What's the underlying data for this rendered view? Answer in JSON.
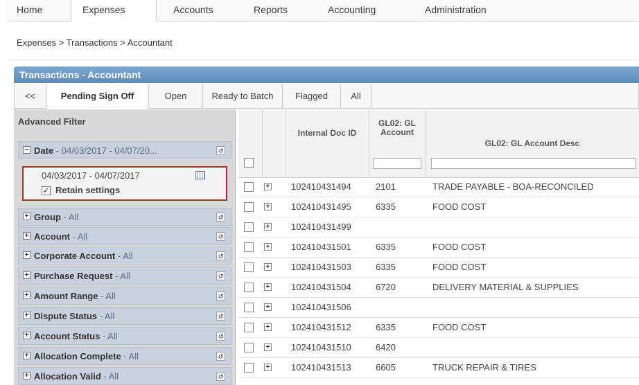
{
  "topnav": {
    "tabs": [
      {
        "label": "Home",
        "active": false
      },
      {
        "label": "Expenses",
        "active": true
      },
      {
        "label": "Accounts",
        "active": false
      },
      {
        "label": "Reports",
        "active": false
      },
      {
        "label": "Accounting",
        "active": false
      },
      {
        "label": "Administration",
        "active": false
      }
    ]
  },
  "breadcrumb": "Expenses > Transactions > Accountant",
  "panel": {
    "title": "Transactions - Accountant"
  },
  "subtabs": [
    {
      "label": "<<"
    },
    {
      "label": "Pending Sign Off",
      "active": true
    },
    {
      "label": "Open"
    },
    {
      "label": "Ready to Batch"
    },
    {
      "label": "Flagged"
    },
    {
      "label": "All"
    }
  ],
  "filter": {
    "title": "Advanced Filter",
    "date": {
      "label": "Date",
      "value": " - 04/03/2017 - 04/07/20...",
      "range": "04/03/2017 - 04/07/2017",
      "retain_label": "Retain settings",
      "retain_checked": true
    },
    "groups": [
      {
        "label": "Group",
        "value": " - All"
      },
      {
        "label": "Account",
        "value": " - All"
      },
      {
        "label": "Corporate Account",
        "value": " - All"
      },
      {
        "label": "Purchase Request",
        "value": " - All"
      },
      {
        "label": "Amount Range",
        "value": " - All"
      },
      {
        "label": "Dispute Status",
        "value": " - All"
      },
      {
        "label": "Account Status",
        "value": " - All"
      },
      {
        "label": "Allocation Complete",
        "value": " - All"
      },
      {
        "label": "Allocation Valid",
        "value": " - All"
      }
    ]
  },
  "grid": {
    "columns": {
      "doc_id": "Internal Doc ID",
      "gl_account": "GL02: GL Account",
      "gl_desc": "GL02: GL Account Desc"
    },
    "rows": [
      {
        "doc_id": "102410431494",
        "gl_account": "2101",
        "gl_desc": "TRADE PAYABLE - BOA-RECONCILED"
      },
      {
        "doc_id": "102410431495",
        "gl_account": "6335",
        "gl_desc": "FOOD COST"
      },
      {
        "doc_id": "102410431499",
        "gl_account": "",
        "gl_desc": ""
      },
      {
        "doc_id": "102410431501",
        "gl_account": "6335",
        "gl_desc": "FOOD COST"
      },
      {
        "doc_id": "102410431503",
        "gl_account": "6335",
        "gl_desc": "FOOD COST"
      },
      {
        "doc_id": "102410431504",
        "gl_account": "6720",
        "gl_desc": "DELIVERY MATERIAL & SUPPLIES"
      },
      {
        "doc_id": "102410431506",
        "gl_account": "",
        "gl_desc": ""
      },
      {
        "doc_id": "102410431512",
        "gl_account": "6335",
        "gl_desc": "FOOD COST"
      },
      {
        "doc_id": "102410431510",
        "gl_account": "6420",
        "gl_desc": ""
      },
      {
        "doc_id": "102410431513",
        "gl_account": "6605",
        "gl_desc": "TRUCK REPAIR & TIRES"
      }
    ]
  }
}
